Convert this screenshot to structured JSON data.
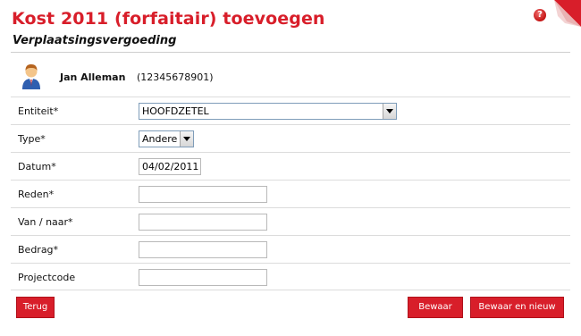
{
  "header": {
    "title": "Kost 2011 (forfaitair) toevoegen",
    "subtitle": "Verplaatsingsvergoeding",
    "help_icon": "question-mark-icon",
    "help_glyph": "?"
  },
  "user": {
    "name": "Jan Alleman",
    "id": "(12345678901)",
    "avatar_icon": "person-icon"
  },
  "form": {
    "entiteit": {
      "label": "Entiteit*",
      "value": "HOOFDZETEL"
    },
    "type": {
      "label": "Type*",
      "value": "Andere"
    },
    "datum": {
      "label": "Datum*",
      "value": "04/02/2011"
    },
    "reden": {
      "label": "Reden*",
      "value": ""
    },
    "van_naar": {
      "label": "Van / naar*",
      "value": ""
    },
    "bedrag": {
      "label": "Bedrag*",
      "value": ""
    },
    "projectcode": {
      "label": "Projectcode",
      "value": ""
    }
  },
  "buttons": {
    "back": "Terug",
    "save": "Bewaar",
    "save_new": "Bewaar en nieuw"
  },
  "colors": {
    "accent": "#d81e2a",
    "rule": "#dcdcdc"
  }
}
